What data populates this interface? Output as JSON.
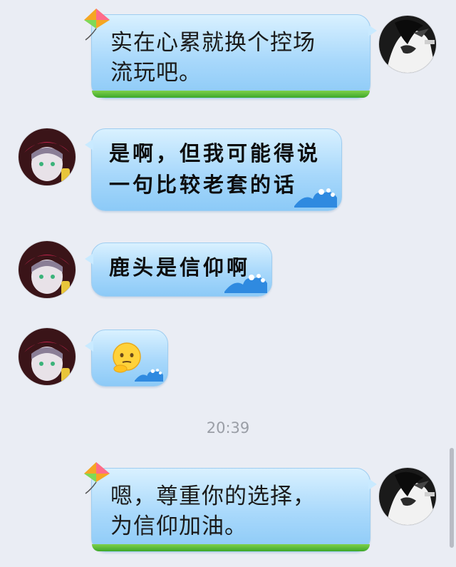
{
  "messages": [
    {
      "id": "m1",
      "direction": "out",
      "text": "实在心累就换个控场\n流玩吧。"
    },
    {
      "id": "m2",
      "direction": "in",
      "text": "是啊，但我可能得说\n一句比较老套的话"
    },
    {
      "id": "m3",
      "direction": "in",
      "text": "鹿头是信仰啊"
    },
    {
      "id": "m4",
      "direction": "in",
      "emoji": "thinking-face-emoji"
    },
    {
      "id": "m5",
      "direction": "out",
      "text": "嗯，尊重你的选择，\n为信仰加油。"
    }
  ],
  "timestamp": "20:39",
  "colors": {
    "background": "#eaedf4",
    "bubble_top": "#d9f1ff",
    "bubble_bottom": "#8ccaf7",
    "grass": "#3da82a",
    "timestamp": "#9a9ea6"
  },
  "icons": [
    "kite-icon",
    "wave-icon",
    "self-avatar",
    "friend-avatar",
    "thinking-face-emoji"
  ]
}
